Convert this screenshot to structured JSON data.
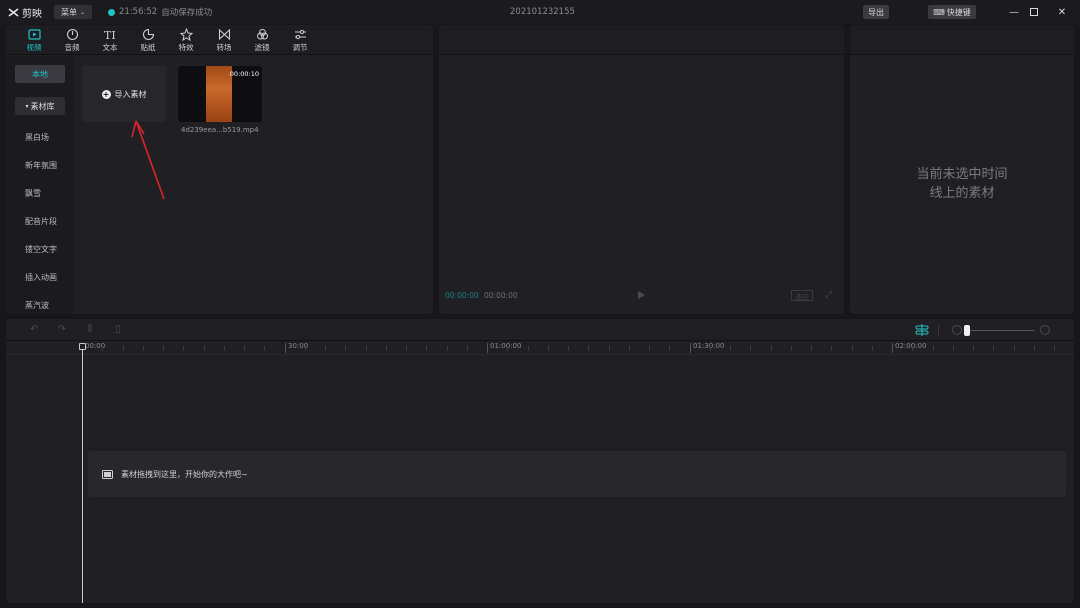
{
  "titlebar": {
    "app_name": "剪映",
    "menu_label": "菜单",
    "save_time": "21:56:52",
    "save_status": "自动保存成功",
    "project_title": "202101232155",
    "export_label": "导出",
    "shortcut_label": "快捷键"
  },
  "media": {
    "tabs": [
      {
        "label": "视频",
        "icon": "video-icon",
        "active": true
      },
      {
        "label": "音频",
        "icon": "audio-icon",
        "active": false
      },
      {
        "label": "文本",
        "icon": "text-icon",
        "active": false
      },
      {
        "label": "贴纸",
        "icon": "sticker-icon",
        "active": false
      },
      {
        "label": "特效",
        "icon": "effects-icon",
        "active": false
      },
      {
        "label": "转场",
        "icon": "transition-icon",
        "active": false
      },
      {
        "label": "滤镜",
        "icon": "filter-icon",
        "active": false
      },
      {
        "label": "调节",
        "icon": "adjust-icon",
        "active": false
      }
    ],
    "sidebar": {
      "local": "本地",
      "library": "素材库",
      "items": [
        "黑白场",
        "新年氛围",
        "飘雪",
        "配音片段",
        "镂空文字",
        "插入动画",
        "蒸汽波"
      ]
    },
    "import_label": "导入素材",
    "clip": {
      "duration": "00:00:10",
      "name": "4d239eea...b519.mp4"
    }
  },
  "preview": {
    "time_current": "00:00:00",
    "time_total": "00:00:00",
    "ratio_label": "适应"
  },
  "properties": {
    "empty_line1": "当前未选中时间",
    "empty_line2": "线上的素材"
  },
  "timeline": {
    "ruler_labels": [
      "00:00",
      "30:00",
      "01:00:00",
      "01:30:00",
      "02:00:00"
    ],
    "drop_hint": "素材拖拽到这里，开始你的大作吧~",
    "zoom_level": 0.05
  },
  "colors": {
    "accent": "#1fc3c3",
    "background": "#17171a",
    "panel": "#202024"
  }
}
